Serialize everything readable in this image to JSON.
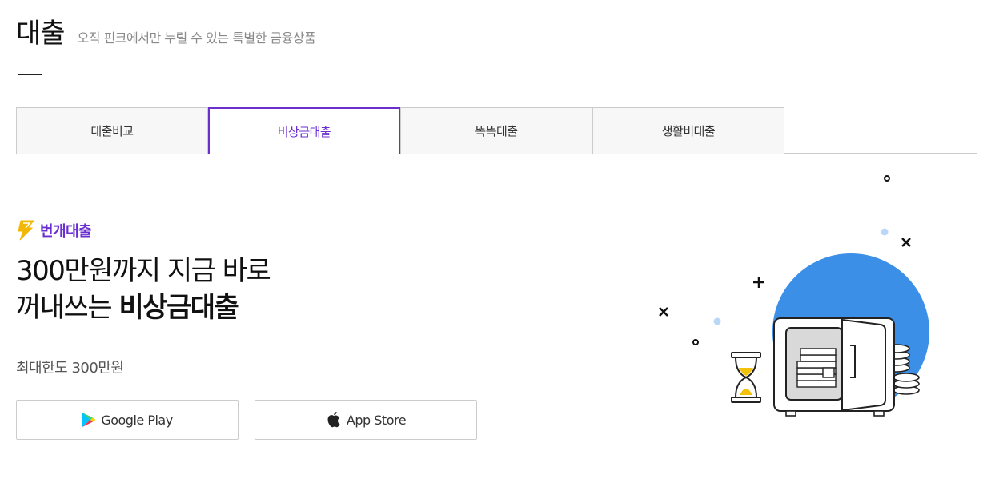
{
  "header": {
    "title": "대출",
    "subtitle": "오직 핀크에서만 누릴 수 있는 특별한 금융상품"
  },
  "tabs": [
    {
      "label": "대출비교",
      "active": false
    },
    {
      "label": "비상금대출",
      "active": true
    },
    {
      "label": "똑똑대출",
      "active": false
    },
    {
      "label": "생활비대출",
      "active": false
    }
  ],
  "product": {
    "badge_icon": "lightning-bolt-icon",
    "badge_label": "번개대출",
    "headline_line1": "300만원까지 지금 바로",
    "headline_line2_prefix": "꺼내쓰는 ",
    "headline_line2_strong": "비상금대출",
    "limit_text": "최대한도 300만원"
  },
  "store_buttons": {
    "google_play_label": "Google Play",
    "google_play_icon": "google-play-icon",
    "app_store_label": "App Store",
    "app_store_icon": "apple-icon"
  },
  "colors": {
    "accent_purple": "#6b2fcf",
    "badge_yellow": "#f2b705",
    "illustration_blue": "#3b8fe6"
  }
}
